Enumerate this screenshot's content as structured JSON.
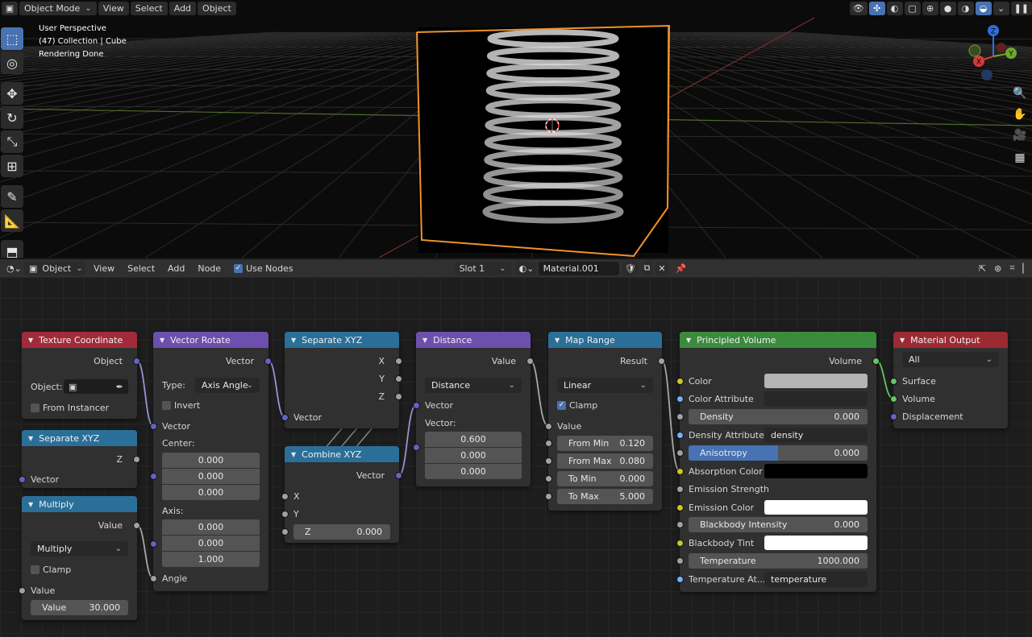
{
  "viewport": {
    "mode_label": "Object Mode",
    "menu": [
      "View",
      "Select",
      "Add",
      "Object"
    ],
    "info": [
      "User Perspective",
      "(47) Collection | Cube",
      "Rendering Done"
    ],
    "gizmo_axes": {
      "z": "Z",
      "y": "Y",
      "x": "X"
    }
  },
  "node_editor": {
    "header": {
      "object_label": "Object",
      "menu": [
        "View",
        "Select",
        "Add",
        "Node"
      ],
      "use_nodes_label": "Use Nodes",
      "slot_label": "Slot 1",
      "material_name": "Material.001"
    },
    "nodes": {
      "texture_coordinate": {
        "title": "Texture Coordinate",
        "out_object": "Object",
        "object_label": "Object:",
        "from_instancer": "From Instancer"
      },
      "separate_xyz_small": {
        "title": "Separate XYZ",
        "out_z": "Z",
        "in_vector": "Vector"
      },
      "multiply": {
        "title": "Multiply",
        "out_value": "Value",
        "operation": "Multiply",
        "clamp": "Clamp",
        "in_value": "Value",
        "value_label": "Value",
        "value": "30.000"
      },
      "vector_rotate": {
        "title": "Vector Rotate",
        "out_vector": "Vector",
        "type_label": "Type:",
        "type_value": "Axis Angle",
        "invert": "Invert",
        "in_vector": "Vector",
        "center_label": "Center:",
        "center": [
          "0.000",
          "0.000",
          "0.000"
        ],
        "axis_label": "Axis:",
        "axis": [
          "0.000",
          "0.000",
          "1.000"
        ],
        "in_angle": "Angle"
      },
      "separate_xyz": {
        "title": "Separate XYZ",
        "out_x": "X",
        "out_y": "Y",
        "out_z": "Z",
        "in_vector": "Vector"
      },
      "combine_xyz": {
        "title": "Combine XYZ",
        "out_vector": "Vector",
        "in_x": "X",
        "in_y": "Y",
        "z_label": "Z",
        "z_value": "0.000"
      },
      "distance": {
        "title": "Distance",
        "out_value": "Value",
        "operation": "Distance",
        "in_vector": "Vector",
        "vector_label": "Vector:",
        "vector": [
          "0.600",
          "0.000",
          "0.000"
        ]
      },
      "map_range": {
        "title": "Map Range",
        "out_result": "Result",
        "interpolation": "Linear",
        "clamp": "Clamp",
        "in_value": "Value",
        "from_min_label": "From Min",
        "from_min": "0.120",
        "from_max_label": "From Max",
        "from_max": "0.080",
        "to_min_label": "To Min",
        "to_min": "0.000",
        "to_max_label": "To Max",
        "to_max": "5.000"
      },
      "principled_volume": {
        "title": "Principled Volume",
        "out_volume": "Volume",
        "color": "Color",
        "color_attribute": "Color Attribute",
        "density_label": "Density",
        "density": "0.000",
        "density_attribute": "Density Attribute",
        "density_attribute_value": "density",
        "anisotropy_label": "Anisotropy",
        "anisotropy": "0.000",
        "anisotropy_fill": 0.5,
        "absorption_color": "Absorption Color",
        "emission_strength": "Emission Strength",
        "emission_color": "Emission Color",
        "blackbody_intensity_label": "Blackbody Intensity",
        "blackbody_intensity": "0.000",
        "blackbody_tint": "Blackbody Tint",
        "temperature_label": "Temperature",
        "temperature": "1000.000",
        "temperature_attribute": "Temperature At...",
        "temperature_attribute_value": "temperature",
        "color_swatch": "#b4b4b4",
        "absorption_swatch": "#000000",
        "emission_swatch": "#ffffff",
        "tint_swatch": "#ffffff"
      },
      "material_output": {
        "title": "Material Output",
        "target": "All",
        "in_surface": "Surface",
        "in_volume": "Volume",
        "in_displacement": "Displacement"
      }
    }
  },
  "colors": {
    "accent": "#4772b3",
    "selection_outline": "#f0922a"
  }
}
